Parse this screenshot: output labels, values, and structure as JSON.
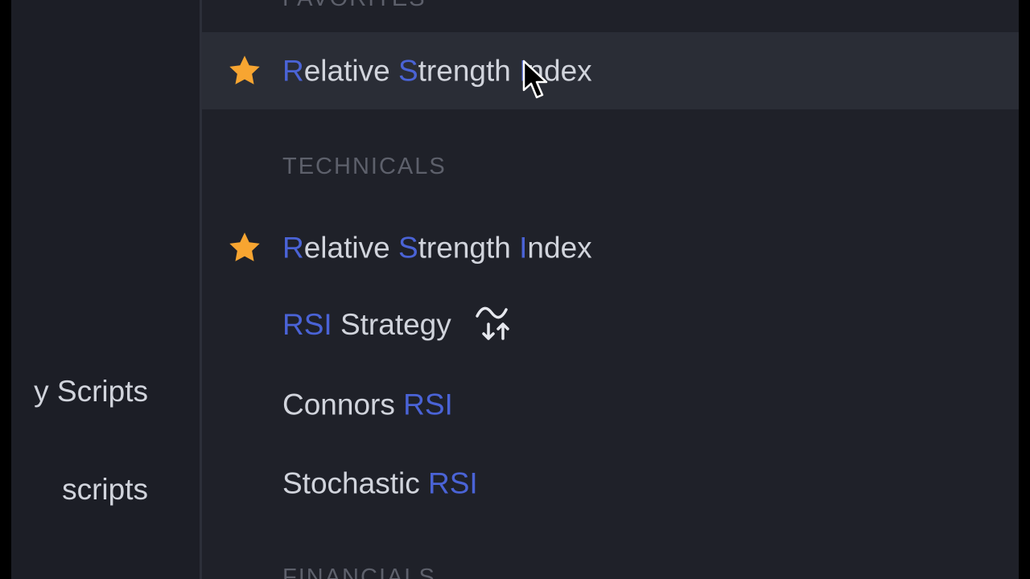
{
  "sidebar": {
    "items": [
      {
        "label": "y Scripts"
      },
      {
        "label": "scripts"
      }
    ]
  },
  "main": {
    "top_section_heading": "FAVORITES",
    "favorites": [
      {
        "parts": [
          {
            "text": "R",
            "hl": true
          },
          {
            "text": "elative ",
            "hl": false
          },
          {
            "text": "S",
            "hl": true
          },
          {
            "text": "trength ",
            "hl": false
          },
          {
            "text": "I",
            "hl": true
          },
          {
            "text": "ndex",
            "hl": false
          }
        ],
        "starred": true
      }
    ],
    "technicals_heading": "TECHNICALS",
    "technicals": [
      {
        "parts": [
          {
            "text": "R",
            "hl": true
          },
          {
            "text": "elative ",
            "hl": false
          },
          {
            "text": "S",
            "hl": true
          },
          {
            "text": "trength ",
            "hl": false
          },
          {
            "text": "I",
            "hl": true
          },
          {
            "text": "ndex",
            "hl": false
          }
        ],
        "starred": true
      },
      {
        "parts": [
          {
            "text": "RSI",
            "hl": true
          },
          {
            "text": " Strategy",
            "hl": false
          }
        ],
        "icon": "strategy-icon"
      },
      {
        "parts": [
          {
            "text": "Connors ",
            "hl": false
          },
          {
            "text": "RSI",
            "hl": true
          }
        ]
      },
      {
        "parts": [
          {
            "text": "Stochastic ",
            "hl": false
          },
          {
            "text": "RSI",
            "hl": true
          }
        ]
      }
    ],
    "bottom_section_heading": "FINANCIALS"
  },
  "colors": {
    "highlight": "#4a63d6",
    "star": "#f7a531",
    "text": "#d1d4dc",
    "heading": "#5d606b"
  }
}
